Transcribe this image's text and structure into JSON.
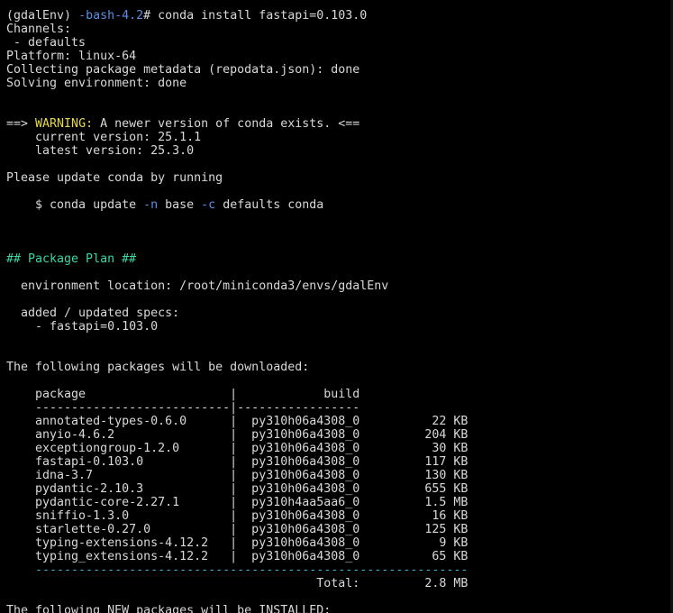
{
  "terminal": {
    "colors": {
      "background": "#000000",
      "foreground": "#d9d9d9",
      "prompt_blue": "#5b8ee6",
      "warning_yellow": "#e6d84a",
      "heading_green": "#3ad6a6",
      "separator_cyan": "#3ab3d6"
    },
    "lines": [
      [
        {
          "t": "(gdalEnv) "
        },
        {
          "t": "-bash-4.2",
          "c": "blue"
        },
        {
          "t": "# conda install fastapi=0.103.0"
        }
      ],
      [
        {
          "t": "Channels:"
        }
      ],
      [
        {
          "t": " - defaults"
        }
      ],
      [
        {
          "t": "Platform: linux-64"
        }
      ],
      [
        {
          "t": "Collecting package metadata (repodata.json): done"
        }
      ],
      [
        {
          "t": "Solving environment: done"
        }
      ],
      [],
      [],
      [
        {
          "t": "==> "
        },
        {
          "t": "WARNING:",
          "c": "yellow"
        },
        {
          "t": " A newer version of conda exists. <=="
        }
      ],
      [
        {
          "t": "    current version: 25.1.1"
        }
      ],
      [
        {
          "t": "    latest version: 25.3.0"
        }
      ],
      [],
      [
        {
          "t": "Please update conda by running"
        }
      ],
      [],
      [
        {
          "t": "    $ conda update "
        },
        {
          "t": "-n",
          "c": "blue"
        },
        {
          "t": " base "
        },
        {
          "t": "-c",
          "c": "blue"
        },
        {
          "t": " defaults conda"
        }
      ],
      [],
      [],
      [],
      [
        {
          "t": "## Package Plan ##",
          "c": "green"
        }
      ],
      [],
      [
        {
          "t": "  environment location: /root/miniconda3/envs/gdalEnv"
        }
      ],
      [],
      [
        {
          "t": "  added / updated specs:"
        }
      ],
      [
        {
          "t": "    - fastapi=0.103.0"
        }
      ],
      [],
      [],
      [
        {
          "t": "The following packages will be downloaded:"
        }
      ],
      [],
      [
        {
          "t": "    package                    |            build"
        }
      ],
      [
        {
          "t": "    ---------------------------|-----------------"
        }
      ],
      [
        {
          "t": "    annotated-types-0.6.0      |  py310h06a4308_0          22 KB"
        }
      ],
      [
        {
          "t": "    anyio-4.6.2                |  py310h06a4308_0         204 KB"
        }
      ],
      [
        {
          "t": "    exceptiongroup-1.2.0       |  py310h06a4308_0          30 KB"
        }
      ],
      [
        {
          "t": "    fastapi-0.103.0            |  py310h06a4308_0         117 KB"
        }
      ],
      [
        {
          "t": "    idna-3.7                   |  py310h06a4308_0         130 KB"
        }
      ],
      [
        {
          "t": "    pydantic-2.10.3            |  py310h06a4308_0         655 KB"
        }
      ],
      [
        {
          "t": "    pydantic-core-2.27.1       |  py310h4aa5aa6_0         1.5 MB"
        }
      ],
      [
        {
          "t": "    sniffio-1.3.0              |  py310h06a4308_0          16 KB"
        }
      ],
      [
        {
          "t": "    starlette-0.27.0           |  py310h06a4308_0         125 KB"
        }
      ],
      [
        {
          "t": "    typing-extensions-4.12.2   |  py310h06a4308_0           9 KB"
        }
      ],
      [
        {
          "t": "    typing_extensions-4.12.2   |  py310h06a4308_0          65 KB"
        }
      ],
      [
        {
          "t": "    ------------------------------------------------------------",
          "c": "dashes"
        }
      ],
      [
        {
          "t": "                                           Total:         2.8 MB"
        }
      ],
      [],
      [
        {
          "t": "The following NEW packages will be INSTALLED:"
        }
      ]
    ]
  }
}
